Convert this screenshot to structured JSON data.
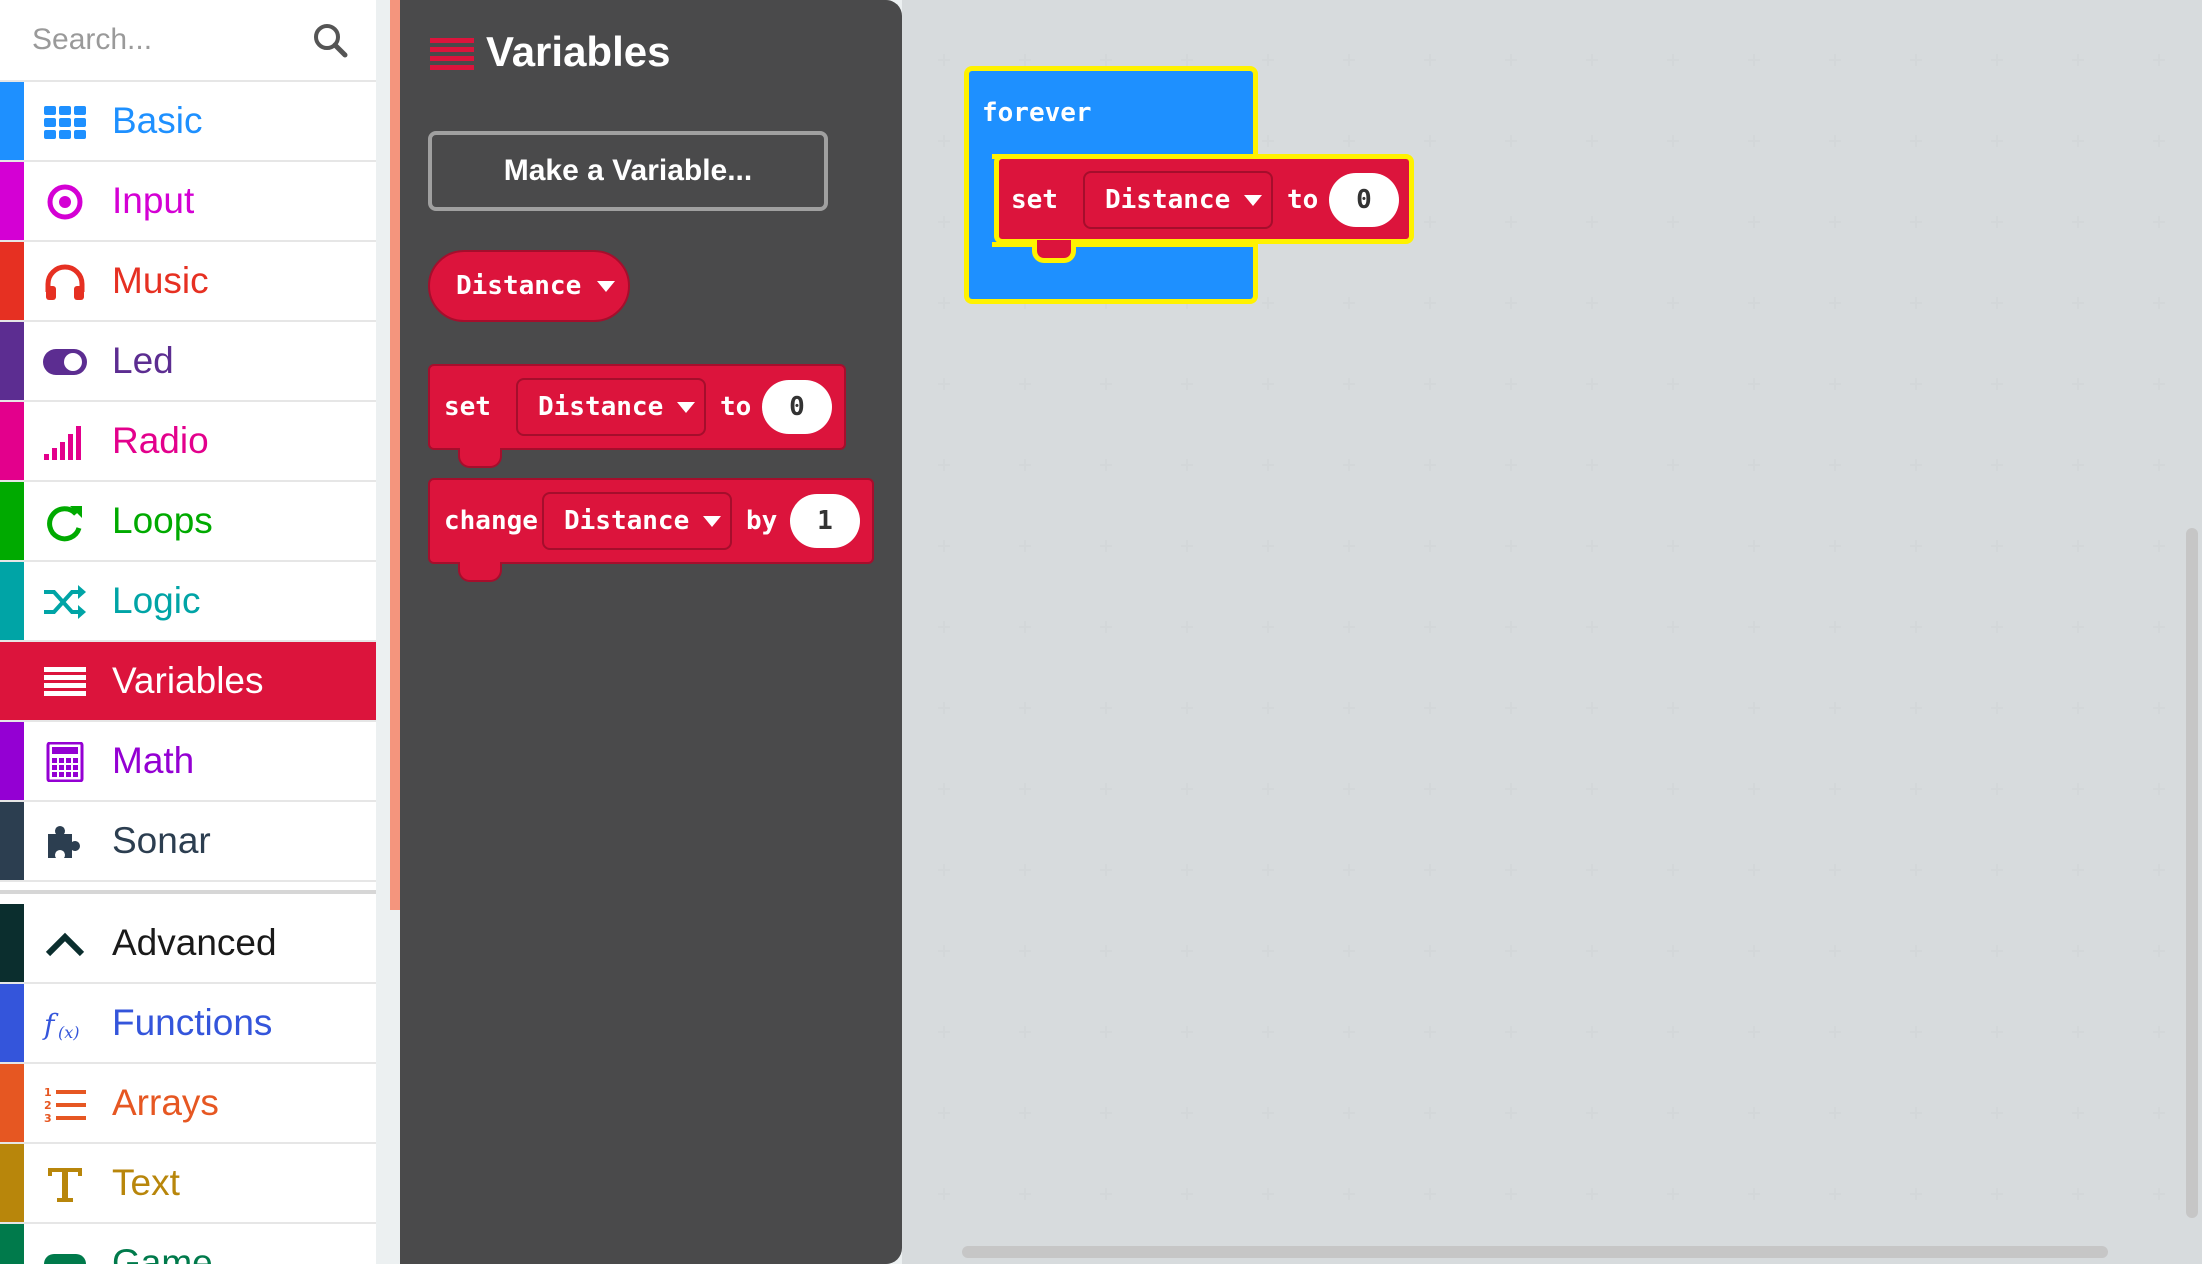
{
  "search": {
    "placeholder": "Search...",
    "icon": "search-icon"
  },
  "categories": [
    {
      "label": "Basic",
      "color": "#1e90ff",
      "icon": "grid-icon"
    },
    {
      "label": "Input",
      "color": "#d400d4",
      "icon": "target-icon"
    },
    {
      "label": "Music",
      "color": "#e63022",
      "icon": "headphones-icon"
    },
    {
      "label": "Led",
      "color": "#5c2d91",
      "icon": "toggle-icon"
    },
    {
      "label": "Radio",
      "color": "#e3008c",
      "icon": "signal-icon"
    },
    {
      "label": "Loops",
      "color": "#00aa00",
      "icon": "refresh-icon"
    },
    {
      "label": "Logic",
      "color": "#00a4a6",
      "icon": "shuffle-icon"
    },
    {
      "label": "Variables",
      "color": "#dc143c",
      "icon": "list-icon",
      "selected": true
    },
    {
      "label": "Math",
      "color": "#9400d3",
      "icon": "calculator-icon"
    },
    {
      "label": "Sonar",
      "color": "#2c3e50",
      "icon": "puzzle-icon"
    }
  ],
  "advanced_categories": [
    {
      "label": "Advanced",
      "color": "#0b2e2e",
      "icon": "chevron-up-icon"
    },
    {
      "label": "Functions",
      "color": "#3455db",
      "icon": "function-icon"
    },
    {
      "label": "Arrays",
      "color": "#e65722",
      "icon": "numbered-list-icon"
    },
    {
      "label": "Text",
      "color": "#b8860b",
      "icon": "text-icon"
    },
    {
      "label": "Game",
      "color": "#007a4b",
      "icon": "gamepad-icon"
    }
  ],
  "flyout": {
    "title": "Variables",
    "make_variable_button": "Make a Variable...",
    "variable_reporter": "Distance",
    "set_block": {
      "keyword": "set",
      "variable": "Distance",
      "to": "to",
      "value": "0"
    },
    "change_block": {
      "keyword": "change",
      "variable": "Distance",
      "by": "by",
      "value": "1"
    }
  },
  "workspace": {
    "forever_label": "forever",
    "set_block": {
      "keyword": "set",
      "variable": "Distance",
      "to": "to",
      "value": "0"
    }
  },
  "colors": {
    "variables": "#dc143c",
    "basic": "#1e90ff",
    "highlight": "#fff200",
    "flyout_bg": "#4a4a4b",
    "workspace_bg": "#ecf0f1"
  }
}
